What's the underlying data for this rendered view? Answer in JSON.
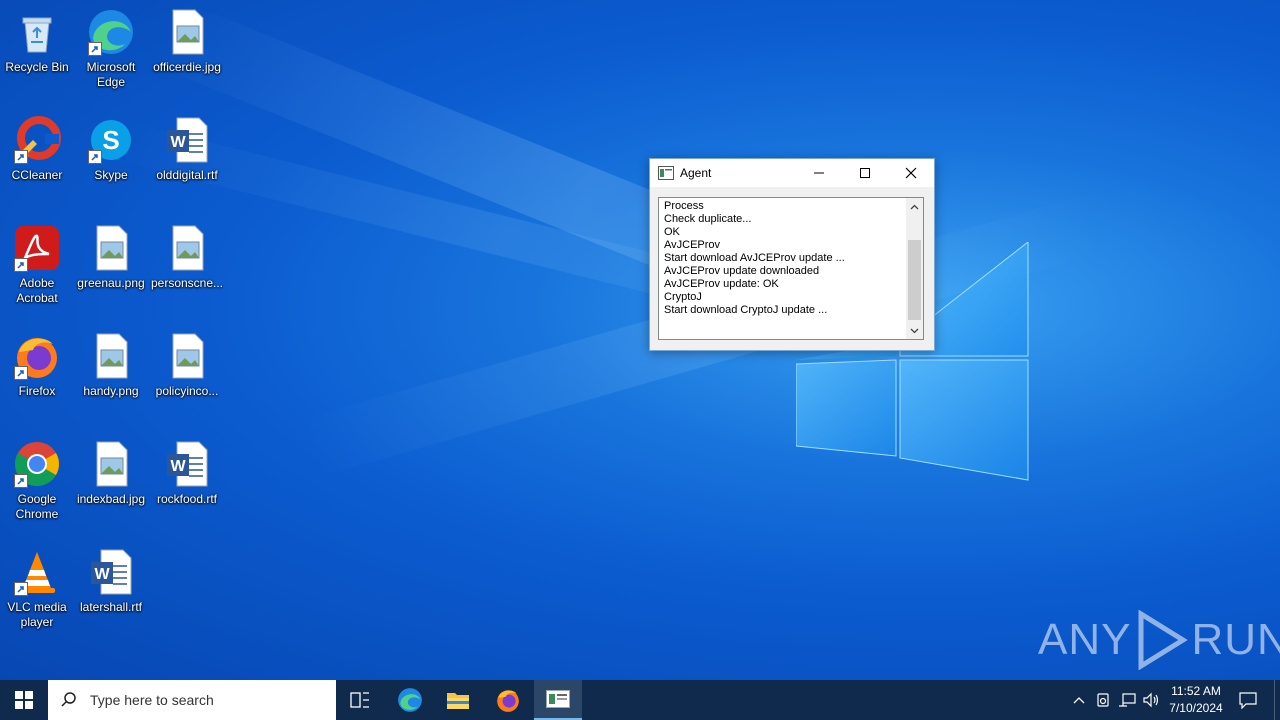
{
  "desktop": {
    "icons": [
      {
        "label": "Recycle Bin"
      },
      {
        "label": "Microsoft Edge"
      },
      {
        "label": "officerdie.jpg"
      },
      {
        "label": "CCleaner"
      },
      {
        "label": "Skype"
      },
      {
        "label": "olddigital.rtf"
      },
      {
        "label": "Adobe Acrobat"
      },
      {
        "label": "greenau.png"
      },
      {
        "label": "personscne..."
      },
      {
        "label": "Firefox"
      },
      {
        "label": "handy.png"
      },
      {
        "label": "policyinco..."
      },
      {
        "label": "Google Chrome"
      },
      {
        "label": "indexbad.jpg"
      },
      {
        "label": "rockfood.rtf"
      },
      {
        "label": "VLC media player"
      },
      {
        "label": "latershall.rtf"
      }
    ],
    "watermark_left": "ANY",
    "watermark_right": "RUN"
  },
  "agent_window": {
    "title": "Agent",
    "log_lines": [
      "Process",
      "Check duplicate...",
      "OK",
      "AvJCEProv",
      "Start download AvJCEProv update ...",
      "AvJCEProv update downloaded",
      "AvJCEProv update: OK",
      "CryptoJ",
      "Start download CryptoJ update ..."
    ]
  },
  "taskbar": {
    "search_placeholder": "Type here to search",
    "clock_time": "11:52 AM",
    "clock_date": "7/10/2024"
  },
  "colors": {
    "desktop_blue": "#0b5bcf",
    "taskbar": "#0f2a4d",
    "window_border": "#7aa7d6"
  }
}
